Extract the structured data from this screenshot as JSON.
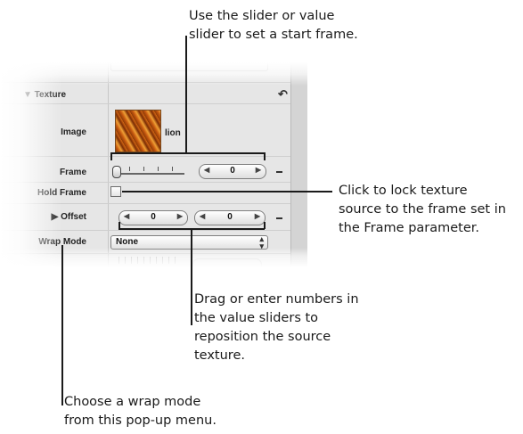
{
  "callouts": {
    "start_frame": [
      "Use the slider or value",
      "slider to set a start frame."
    ],
    "lock_texture": [
      "Click to lock texture",
      "source to the frame set in",
      "the Frame parameter."
    ],
    "drag_numbers": [
      "Drag or enter numbers in",
      "the value sliders to",
      "reposition the source",
      "texture."
    ],
    "wrap_mode": [
      "Choose a wrap mode",
      "from this pop-up menu."
    ]
  },
  "panel": {
    "texture_header": "▼ Texture",
    "reset_icon": "↶",
    "rows": {
      "image_label": "Image",
      "image_name": "lion",
      "frame_label": "Frame",
      "frame_value": "0",
      "hold_frame_label": "Hold Frame",
      "offset_label": "▶ Offset",
      "offset_x": "0",
      "offset_y": "0",
      "wrap_mode_label": "Wrap Mode",
      "wrap_mode_value": "None"
    }
  }
}
